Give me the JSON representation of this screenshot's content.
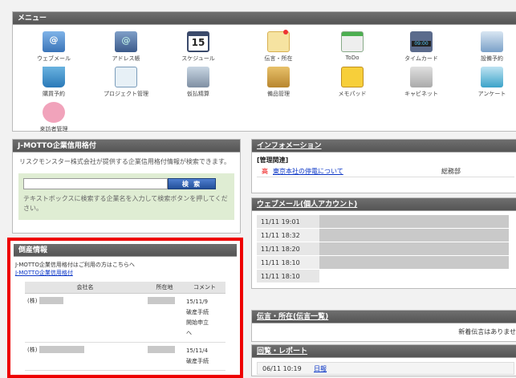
{
  "menu": {
    "title": "メニュー",
    "items": [
      {
        "label": "ウェブメール",
        "icon": "webmail-icon"
      },
      {
        "label": "アドレス帳",
        "icon": "address-book-icon"
      },
      {
        "label": "スケジュール",
        "icon": "calendar-icon"
      },
      {
        "label": "伝言・所在",
        "icon": "memo-icon"
      },
      {
        "label": "ToDo",
        "icon": "todo-icon"
      },
      {
        "label": "タイムカード",
        "icon": "timecard-icon"
      },
      {
        "label": "設備予約",
        "icon": "equipment-icon"
      },
      {
        "label": "購買予約",
        "icon": "cart-icon"
      },
      {
        "label": "プロジェクト管理",
        "icon": "project-icon"
      },
      {
        "label": "仮払精算",
        "icon": "payment-icon"
      },
      {
        "label": "備品管理",
        "icon": "goods-icon"
      },
      {
        "label": "メモパッド",
        "icon": "notepad-icon"
      },
      {
        "label": "キャビネット",
        "icon": "cabinet-icon"
      },
      {
        "label": "アンケート",
        "icon": "survey-icon"
      },
      {
        "label": "来訪者管理",
        "icon": "visitor-icon"
      }
    ]
  },
  "credit": {
    "title": "J-MOTTO企業信用格付",
    "desc": "リスクモンスター株式会社が提供する企業信用格付情報が検索できます。",
    "search_button": "検 索",
    "hint": "テキストボックスに検索する企業名を入力して検索ボタンを押してください。"
  },
  "bankruptcy": {
    "title": "倒産情報",
    "notice": "J-MOTTO企業信用格付はご利用の方はこちらへ",
    "link": "J-MOTTO企業信用格付",
    "columns": [
      "会社名",
      "所在地",
      "コメント"
    ],
    "rows": [
      {
        "company_prefix": "(株)",
        "comment": [
          "15/11/9",
          "破産手続",
          "開始申立",
          "へ"
        ]
      },
      {
        "company_prefix": "(株)",
        "comment": [
          "15/11/4",
          "破産手続"
        ]
      }
    ]
  },
  "information": {
    "title": "インフォメーション",
    "category": "[管理関連]",
    "items": [
      {
        "priority": "高",
        "subject": "東京本社の停電について",
        "dept": "総務部"
      }
    ]
  },
  "webmail": {
    "title": "ウェブメール(個人アカウント)",
    "times": [
      "11/11 19:01",
      "11/11 18:32",
      "11/11 18:20",
      "11/11 18:10",
      "11/11 18:10"
    ]
  },
  "dengon": {
    "title": "伝言・所在(伝言一覧)",
    "empty": "新着伝言はありませ"
  },
  "kairan": {
    "title": "回覧・レポート",
    "items": [
      {
        "time": "06/11 10:19",
        "subject": "日報"
      }
    ]
  }
}
